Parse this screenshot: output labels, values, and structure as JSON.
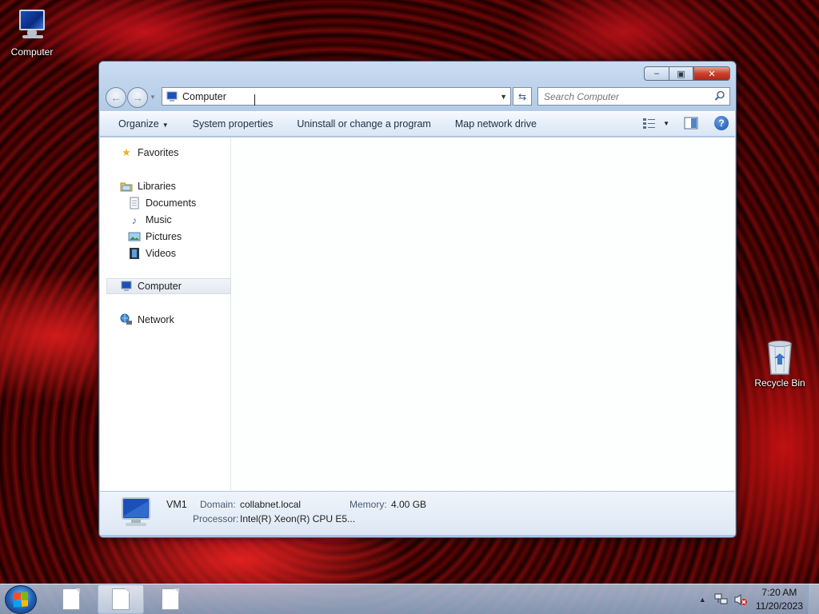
{
  "desktop": {
    "icons": [
      {
        "label": "Computer",
        "icon": "computer-icon"
      },
      {
        "label": "Recycle Bin",
        "icon": "recycle-bin-icon"
      }
    ]
  },
  "window": {
    "controls": {
      "minimize": "minimize-icon",
      "maximize": "maximize-icon",
      "close": "close-icon"
    },
    "address": {
      "value": "Computer"
    },
    "search": {
      "placeholder": "Search Computer"
    },
    "toolbar": {
      "organize": "Organize",
      "system_properties": "System properties",
      "uninstall": "Uninstall or change a program",
      "map_drive": "Map network drive"
    },
    "nav": {
      "favorites": "Favorites",
      "libraries": "Libraries",
      "documents": "Documents",
      "music": "Music",
      "pictures": "Pictures",
      "videos": "Videos",
      "computer": "Computer",
      "network": "Network"
    },
    "details": {
      "name": "VM1",
      "domain_label": "Domain:",
      "domain_value": "collabnet.local",
      "memory_label": "Memory:",
      "memory_value": "4.00 GB",
      "processor_label": "Processor:",
      "processor_value": "Intel(R) Xeon(R) CPU E5..."
    }
  },
  "taskbar": {
    "clock": {
      "time": "7:20 AM",
      "date": "11/20/2023"
    }
  }
}
